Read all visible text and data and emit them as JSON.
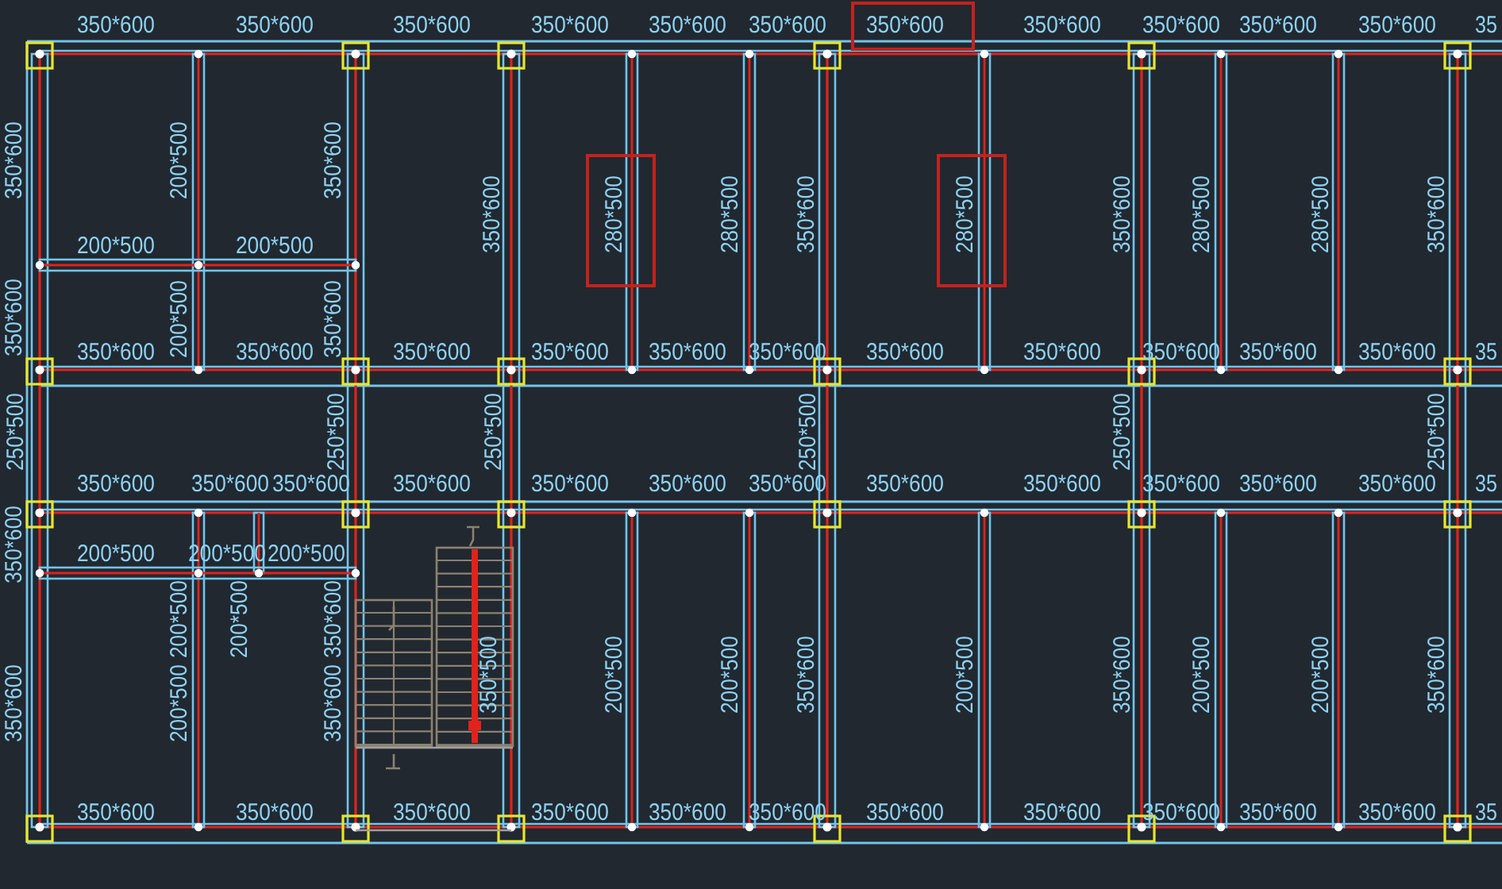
{
  "drawing": {
    "horizontal_labels": [
      {
        "text": "350*600",
        "highlighted": false
      },
      {
        "text": "350*600",
        "highlighted": false
      },
      {
        "text": "350*600",
        "highlighted": false
      },
      {
        "text": "350*600",
        "highlighted": false
      },
      {
        "text": "350*600",
        "highlighted": false
      },
      {
        "text": "350*600",
        "highlighted": false
      },
      {
        "text": "350*600",
        "highlighted": true
      },
      {
        "text": "350*600",
        "highlighted": false
      },
      {
        "text": "350*600",
        "highlighted": false
      },
      {
        "text": "350*600",
        "highlighted": false
      },
      {
        "text": "350*600",
        "highlighted": false
      },
      {
        "text": "35",
        "highlighted": false
      },
      {
        "text": "200*500",
        "highlighted": false
      },
      {
        "text": "200*500",
        "highlighted": false
      },
      {
        "text": "350*600",
        "highlighted": false
      },
      {
        "text": "350*600",
        "highlighted": false
      },
      {
        "text": "350*600",
        "highlighted": false
      },
      {
        "text": "350*600",
        "highlighted": false
      },
      {
        "text": "350*600",
        "highlighted": false
      },
      {
        "text": "350*600",
        "highlighted": false
      },
      {
        "text": "350*600",
        "highlighted": false
      },
      {
        "text": "350*600",
        "highlighted": false
      },
      {
        "text": "350*600",
        "highlighted": false
      },
      {
        "text": "350*600",
        "highlighted": false
      },
      {
        "text": "350*600",
        "highlighted": false
      },
      {
        "text": "35",
        "highlighted": false
      },
      {
        "text": "350*600",
        "highlighted": false
      },
      {
        "text": "350*600",
        "highlighted": false
      },
      {
        "text": "350*600",
        "highlighted": false
      },
      {
        "text": "350*600",
        "highlighted": false
      },
      {
        "text": "350*600",
        "highlighted": false
      },
      {
        "text": "350*600",
        "highlighted": false
      },
      {
        "text": "350*600",
        "highlighted": false
      },
      {
        "text": "350*600",
        "highlighted": false
      },
      {
        "text": "350*600",
        "highlighted": false
      },
      {
        "text": "350*600",
        "highlighted": false
      },
      {
        "text": "350*600",
        "highlighted": false
      },
      {
        "text": "350*600",
        "highlighted": false
      },
      {
        "text": "35",
        "highlighted": false
      },
      {
        "text": "200*500",
        "highlighted": false
      },
      {
        "text": "200*500",
        "highlighted": false
      },
      {
        "text": "200*500",
        "highlighted": false
      },
      {
        "text": "350*600",
        "highlighted": false
      },
      {
        "text": "350*600",
        "highlighted": false
      },
      {
        "text": "350*600",
        "highlighted": false
      },
      {
        "text": "350*600",
        "highlighted": false
      },
      {
        "text": "350*600",
        "highlighted": false
      },
      {
        "text": "350*600",
        "highlighted": false
      },
      {
        "text": "350*600",
        "highlighted": false
      },
      {
        "text": "350*600",
        "highlighted": false
      },
      {
        "text": "350*600",
        "highlighted": false
      },
      {
        "text": "350*600",
        "highlighted": false
      },
      {
        "text": "350*600",
        "highlighted": false
      },
      {
        "text": "35",
        "highlighted": false
      }
    ],
    "vertical_labels": [
      {
        "text": "350*600",
        "highlighted": false
      },
      {
        "text": "200*500",
        "highlighted": false
      },
      {
        "text": "350*600",
        "highlighted": false
      },
      {
        "text": "350*600",
        "highlighted": false
      },
      {
        "text": "280*500",
        "highlighted": true
      },
      {
        "text": "280*500",
        "highlighted": false
      },
      {
        "text": "350*600",
        "highlighted": false
      },
      {
        "text": "280*500",
        "highlighted": true
      },
      {
        "text": "350*600",
        "highlighted": false
      },
      {
        "text": "280*500",
        "highlighted": false
      },
      {
        "text": "280*500",
        "highlighted": false
      },
      {
        "text": "350*600",
        "highlighted": false
      },
      {
        "text": "350*600",
        "highlighted": false
      },
      {
        "text": "200*500",
        "highlighted": false
      },
      {
        "text": "350*600",
        "highlighted": false
      },
      {
        "text": "250*500",
        "highlighted": false
      },
      {
        "text": "250*500",
        "highlighted": false
      },
      {
        "text": "250*500",
        "highlighted": false
      },
      {
        "text": "250*500",
        "highlighted": false
      },
      {
        "text": "250*500",
        "highlighted": false
      },
      {
        "text": "250*500",
        "highlighted": false
      },
      {
        "text": "350*600",
        "highlighted": false
      },
      {
        "text": "200*500",
        "highlighted": false
      },
      {
        "text": "200*500",
        "highlighted": false
      },
      {
        "text": "350*600",
        "highlighted": false
      },
      {
        "text": "350*500",
        "highlighted": false
      },
      {
        "text": "200*500",
        "highlighted": false
      },
      {
        "text": "200*500",
        "highlighted": false
      },
      {
        "text": "350*600",
        "highlighted": false
      },
      {
        "text": "200*500",
        "highlighted": false
      },
      {
        "text": "350*600",
        "highlighted": false
      },
      {
        "text": "200*500",
        "highlighted": false
      },
      {
        "text": "200*500",
        "highlighted": false
      },
      {
        "text": "350*600",
        "highlighted": false
      },
      {
        "text": "350*600",
        "highlighted": false
      },
      {
        "text": "200*500",
        "highlighted": false
      },
      {
        "text": "350*600",
        "highlighted": false
      }
    ]
  }
}
